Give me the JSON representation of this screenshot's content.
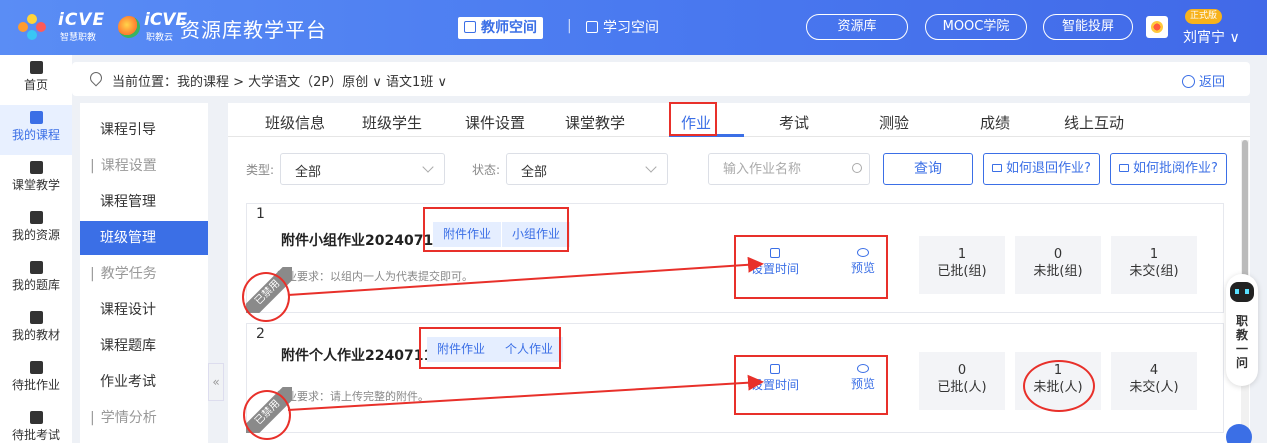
{
  "topbar": {
    "logo1_text": "iCVE",
    "logo1_sub": "智慧职教",
    "logo2_text": "iCVE",
    "logo2_sub": "职教云",
    "app_title": "资源库教学平台",
    "teacher_space": "教师空间",
    "separator": "|",
    "study_space": "学习空间",
    "pills": [
      "资源库",
      "MOOC学院",
      "智能投屏"
    ],
    "badge": "正式版",
    "username": "刘宵宁 ∨"
  },
  "rail": {
    "items": [
      {
        "label": "首页",
        "icon": "home-icon"
      },
      {
        "label": "我的课程",
        "icon": "book-icon"
      },
      {
        "label": "课堂教学",
        "icon": "play-icon"
      },
      {
        "label": "我的资源",
        "icon": "resource-icon"
      },
      {
        "label": "我的题库",
        "icon": "question-bank-icon"
      },
      {
        "label": "我的教材",
        "icon": "textbook-icon"
      },
      {
        "label": "待批作业",
        "icon": "homework-icon"
      },
      {
        "label": "待批考试",
        "icon": "exam-icon"
      }
    ]
  },
  "breadcrumb": {
    "text": "当前位置：我的课程 > 大学语文（2P）原创 ∨  语文1班 ∨",
    "back": "返回"
  },
  "course_side": {
    "items": [
      {
        "label": "课程引导"
      },
      {
        "label": "课程设置"
      },
      {
        "label": "课程管理"
      },
      {
        "label": "班级管理"
      },
      {
        "label": "教学任务"
      },
      {
        "label": "课程设计"
      },
      {
        "label": "课程题库"
      },
      {
        "label": "作业考试"
      },
      {
        "label": "学情分析"
      }
    ],
    "collapse": "«"
  },
  "tabs": [
    "班级信息",
    "班级学生",
    "课件设置",
    "课堂教学",
    "作业",
    "考试",
    "测验",
    "成绩",
    "线上互动"
  ],
  "filters": {
    "type_label": "类型:",
    "type_value": "全部",
    "status_label": "状态:",
    "status_value": "全部",
    "search_placeholder": "输入作业名称",
    "query": "查询",
    "help1": "如何退回作业?",
    "help2": "如何批阅作业?"
  },
  "assignments": [
    {
      "index": "1",
      "name": "附件小组作业20240711",
      "tags": [
        "附件作业",
        "小组作业"
      ],
      "requirement": "作业要求：以组内一人为代表提交即可。",
      "corner": "已禁用",
      "op_set_time": "设置时间",
      "op_preview": "预览",
      "stats": [
        {
          "value": "1",
          "label": "已批(组)"
        },
        {
          "value": "0",
          "label": "未批(组)"
        },
        {
          "value": "1",
          "label": "未交(组)"
        }
      ]
    },
    {
      "index": "2",
      "name": "附件个人作业2240711",
      "tags": [
        "附件作业",
        "个人作业"
      ],
      "requirement": "作业要求：请上传完整的附件。",
      "corner": "已禁用",
      "op_set_time": "设置时间",
      "op_preview": "预览",
      "stats": [
        {
          "value": "0",
          "label": "已批(人)"
        },
        {
          "value": "1",
          "label": "未批(人)"
        },
        {
          "value": "4",
          "label": "未交(人)"
        }
      ]
    }
  ],
  "float_bot": {
    "text": "职教一问"
  },
  "colors": {
    "primary": "#3b6fe6",
    "annotation": "#e8302a"
  }
}
